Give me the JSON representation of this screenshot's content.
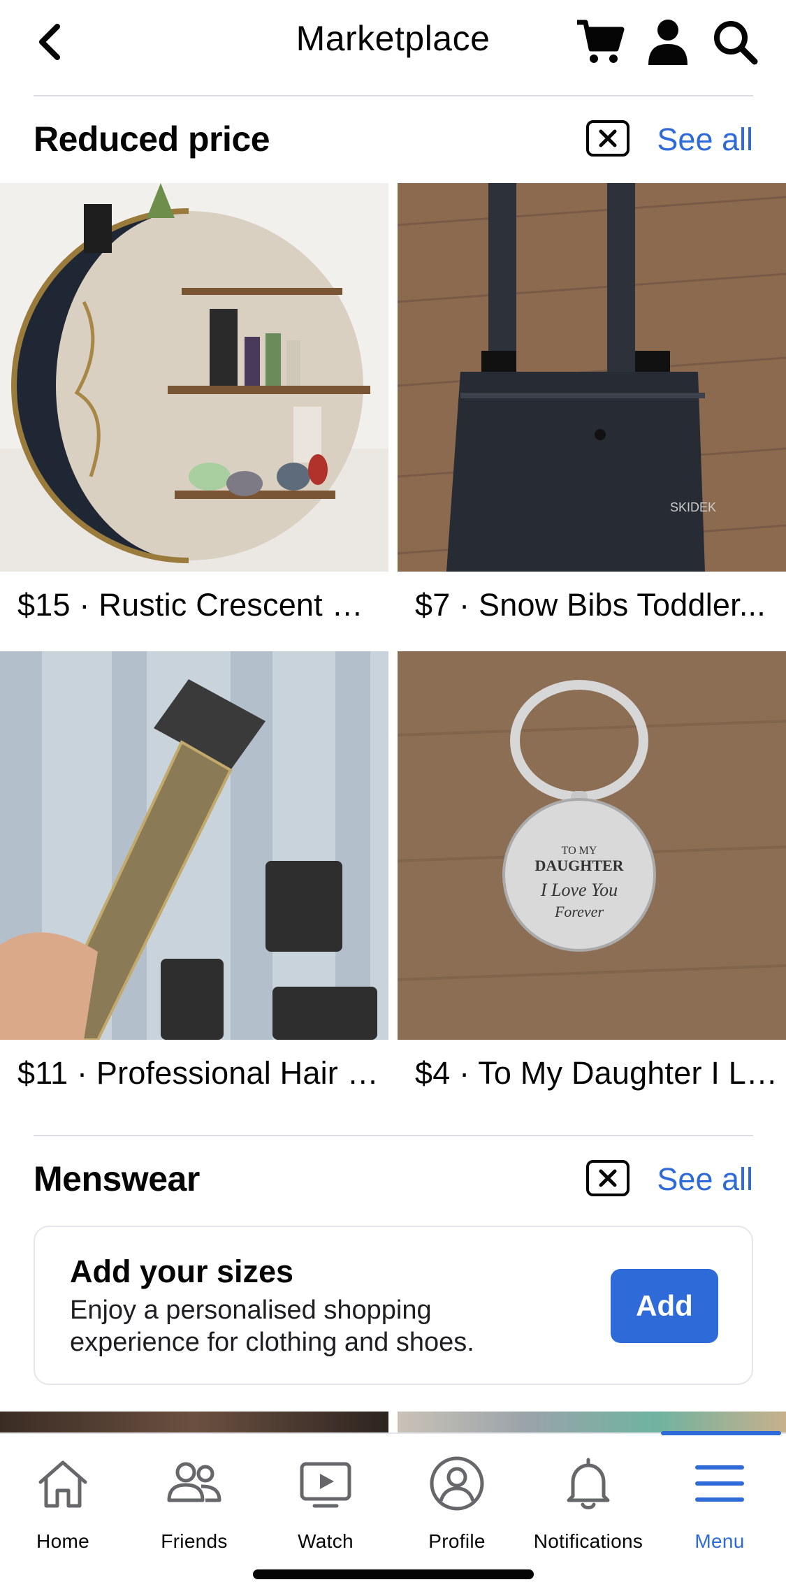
{
  "header": {
    "title": "Marketplace",
    "icons": [
      "back-chevron-icon",
      "cart-icon",
      "person-icon",
      "search-icon"
    ]
  },
  "reduced_price": {
    "title": "Reduced price",
    "see_all": "See all",
    "items": [
      {
        "caption": "$15 · Rustic Crescent M...",
        "image": "crescent-moon-shelf"
      },
      {
        "caption": "$7 · Snow Bibs Toddler...",
        "image": "snow-bibs"
      },
      {
        "caption": "$11 · Professional Hair S...",
        "image": "hair-trimmer"
      },
      {
        "caption": "$4 · To My Daughter I Lo...",
        "image": "keychain"
      }
    ]
  },
  "menswear": {
    "title": "Menswear",
    "see_all": "See all",
    "card": {
      "title": "Add your sizes",
      "description": "Enjoy a personalised shopping experience for clothing and shoes.",
      "button": "Add"
    }
  },
  "tabbar": {
    "tabs": [
      {
        "label": "Home",
        "icon": "home-icon"
      },
      {
        "label": "Friends",
        "icon": "friends-icon"
      },
      {
        "label": "Watch",
        "icon": "watch-icon"
      },
      {
        "label": "Profile",
        "icon": "profile-icon"
      },
      {
        "label": "Notifications",
        "icon": "bell-icon"
      },
      {
        "label": "Menu",
        "icon": "menu-icon",
        "active": true
      }
    ]
  },
  "colors": {
    "accent": "#2f6bd8",
    "text": "#050505",
    "divider": "#dadde1"
  }
}
